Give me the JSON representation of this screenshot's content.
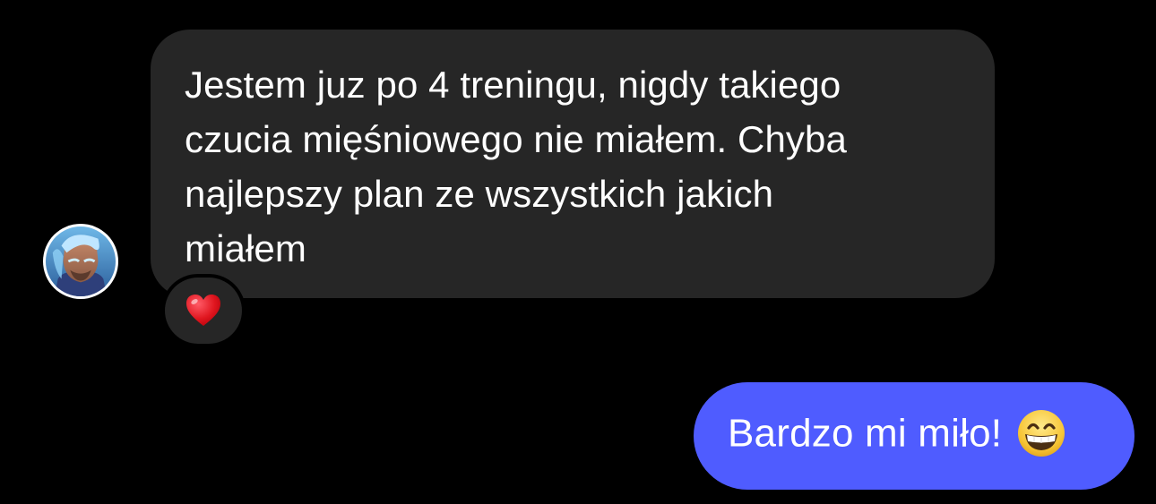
{
  "conversation": {
    "incoming": {
      "text": "Jestem juz po 4 treningu, nigdy takiego\nczucia mięśniowego nie miałem. Chyba\nnajlepszy plan ze wszystkich jakich\nmiałem",
      "reaction": "heart-emoji",
      "avatar": "profile-avatar"
    },
    "outgoing": {
      "text": "Bardzo mi miło!",
      "emoji": "grinning-face-emoji"
    }
  },
  "colors": {
    "background": "#000000",
    "incoming_bubble": "#262626",
    "outgoing_bubble": "#4f5cff",
    "text": "#ffffff"
  }
}
